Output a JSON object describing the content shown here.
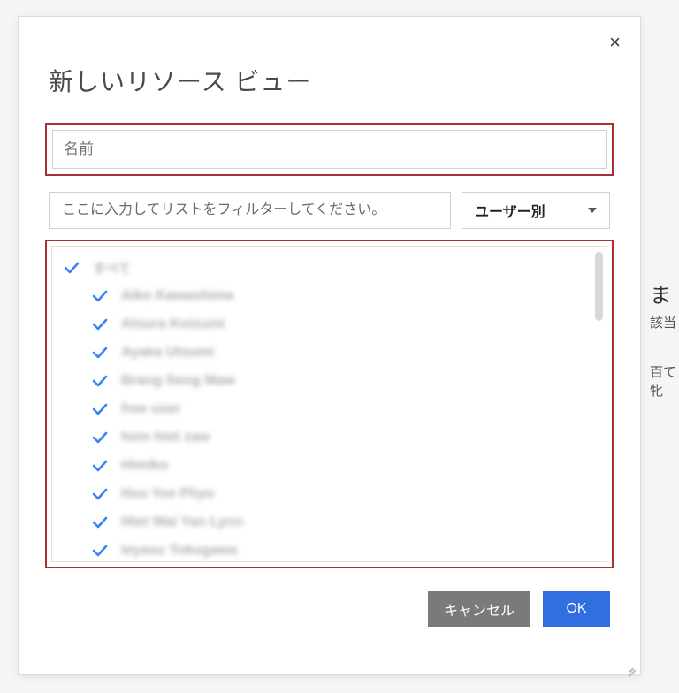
{
  "dialog": {
    "title": "新しいリソース ビュー",
    "close_icon": "×",
    "name_placeholder": "名前",
    "filter_placeholder": "ここに入力してリストをフィルターしてください。",
    "group_by": {
      "selected": "ユーザー別"
    },
    "list": {
      "all_label": "すべて",
      "items": [
        {
          "label": "Aiko Kawashima",
          "checked": true
        },
        {
          "label": "Atsura Koizumi",
          "checked": true
        },
        {
          "label": "Ayaka Utsumi",
          "checked": true
        },
        {
          "label": "Brang Seng Maw",
          "checked": true
        },
        {
          "label": "free user",
          "checked": true
        },
        {
          "label": "hein htet zaw",
          "checked": true
        },
        {
          "label": "Himiko",
          "checked": true
        },
        {
          "label": "Hsu Yee Phyo",
          "checked": true
        },
        {
          "label": "Htet Wai Yan Lynn",
          "checked": true
        },
        {
          "label": "Ieyasu Tokugawa",
          "checked": true
        }
      ]
    },
    "buttons": {
      "cancel": "キャンセル",
      "ok": "OK"
    }
  },
  "background": {
    "b1": "ま",
    "b2": "該当",
    "b3": "百て牝"
  }
}
